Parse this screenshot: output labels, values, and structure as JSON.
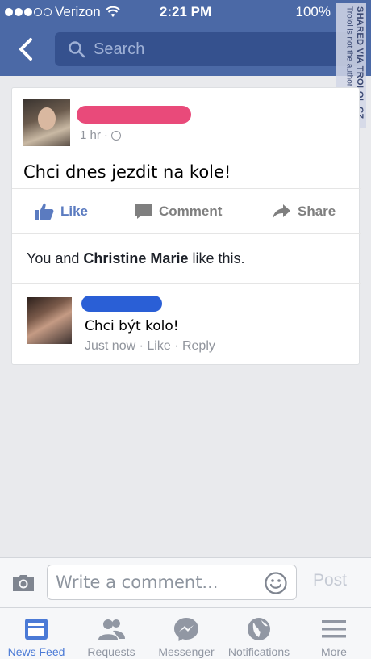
{
  "status_bar": {
    "carrier": "Verizon",
    "time": "2:21 PM",
    "battery": "100%"
  },
  "search": {
    "placeholder": "Search"
  },
  "watermark": {
    "title": "SHARED VIA TROLOL.CZ",
    "subtitle": "Trolol is not the author"
  },
  "post": {
    "time": "1 hr",
    "text": "Chci dnes jezdit na kole!",
    "actions": {
      "like": "Like",
      "comment": "Comment",
      "share": "Share"
    },
    "likes_prefix": "You and ",
    "likes_name": "Christine Marie",
    "likes_suffix": " like this.",
    "comment": {
      "text": "Chci být kolo!",
      "time": "Just now",
      "like": "Like",
      "reply": "Reply"
    }
  },
  "composer": {
    "placeholder": "Write a comment...",
    "post_label": "Post"
  },
  "tabs": [
    {
      "label": "News Feed",
      "icon": "news-feed-icon"
    },
    {
      "label": "Requests",
      "icon": "requests-icon"
    },
    {
      "label": "Messenger",
      "icon": "messenger-icon"
    },
    {
      "label": "Notifications",
      "icon": "notifications-icon"
    },
    {
      "label": "More",
      "icon": "more-icon"
    }
  ],
  "colors": {
    "header": "#4b69a6",
    "like_blue": "#5b7bc0",
    "active_tab": "#4b7ad6",
    "name_redact_red": "#e94a7a",
    "name_redact_blue": "#2a5fd6"
  }
}
